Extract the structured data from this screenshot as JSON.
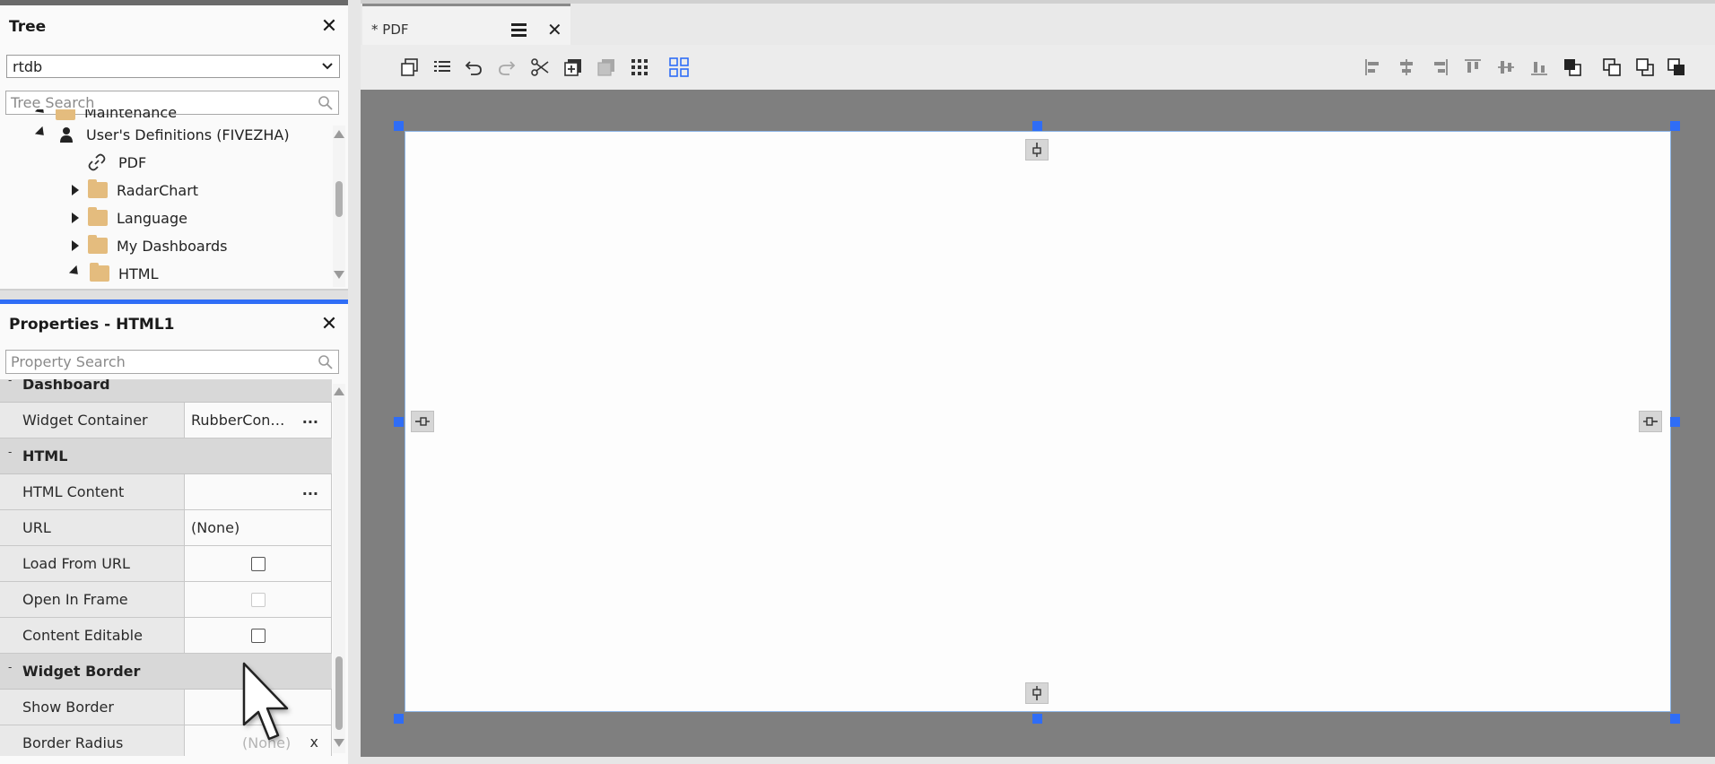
{
  "tree_panel": {
    "title": "Tree",
    "close_glyph": "✕",
    "dropdown_value": "rtdb",
    "search_placeholder": "Tree Search",
    "items": [
      {
        "label": "Maintenance",
        "icon": "folder-icon",
        "expander": "expanded",
        "partial": true
      },
      {
        "label": "User's Definitions (FIVEZHA)",
        "icon": "user-icon",
        "expander": "expanded"
      },
      {
        "label": "PDF",
        "icon": "link-icon",
        "expander": "none"
      },
      {
        "label": "RadarChart",
        "icon": "folder-icon",
        "expander": "collapsed"
      },
      {
        "label": "Language",
        "icon": "folder-icon",
        "expander": "collapsed"
      },
      {
        "label": "My Dashboards",
        "icon": "folder-icon",
        "expander": "collapsed"
      },
      {
        "label": "HTML",
        "icon": "folder-icon",
        "expander": "expanded",
        "partial": true
      }
    ]
  },
  "properties_panel": {
    "title": "Properties - HTML1",
    "close_glyph": "✕",
    "search_placeholder": "Property Search",
    "sections": [
      {
        "kind": "section",
        "label": "Dashboard"
      },
      {
        "kind": "prop",
        "name": "Widget Container",
        "value": "RubberCon…",
        "has_ellipsis": true
      },
      {
        "kind": "section",
        "label": "HTML"
      },
      {
        "kind": "prop",
        "name": "HTML Content",
        "value": "",
        "has_ellipsis": true
      },
      {
        "kind": "prop",
        "name": "URL",
        "value": "(None)"
      },
      {
        "kind": "prop",
        "name": "Load From URL",
        "checkbox": "enabled"
      },
      {
        "kind": "prop",
        "name": "Open In Frame",
        "checkbox": "disabled"
      },
      {
        "kind": "prop",
        "name": "Content Editable",
        "checkbox": "enabled"
      },
      {
        "kind": "section",
        "label": "Widget Border"
      },
      {
        "kind": "prop",
        "name": "Show Border",
        "value": ""
      },
      {
        "kind": "prop",
        "name": "Border Radius",
        "value": "(None)",
        "clear_glyph": "x"
      }
    ]
  },
  "editor": {
    "tab_label": "* PDF",
    "tab_close_glyph": "✕",
    "toolbar_left": [
      "copy-format-icon",
      "list-icon",
      "undo-icon",
      "redo-icon",
      "cut-icon",
      "add-widget-icon",
      "layers-icon",
      "grid-dots-icon",
      "snap-grid-icon"
    ],
    "toolbar_right": [
      "align-left-icon",
      "align-center-icon",
      "align-right-icon",
      "align-top-icon",
      "align-middle-icon",
      "align-bottom-icon",
      "bring-front-icon",
      "group-icon",
      "ungroup-icon",
      "send-back-icon"
    ]
  },
  "colors": {
    "accent": "#2f6df6",
    "canvas_bg": "#7f7f7f",
    "widget_bg": "#fdfdfd",
    "section_bg": "#d8d8d8"
  }
}
